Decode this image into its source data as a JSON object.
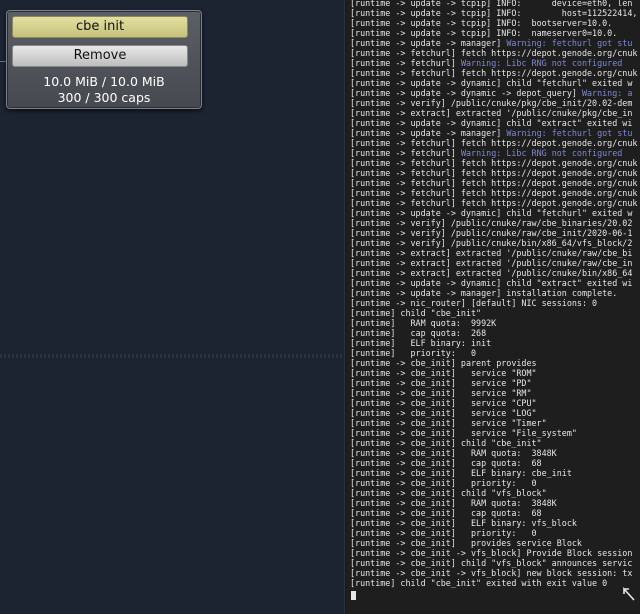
{
  "component_panel": {
    "name_button": "cbe init",
    "remove_button": "Remove",
    "ram_usage": "10.0 MiB / 10.0 MiB",
    "caps_usage": "300 / 300 caps"
  },
  "log": {
    "lines": [
      {
        "prefix": "[runtime -> update -> tcpip] INFO:",
        "text": "      device=eth0, len"
      },
      {
        "prefix": "[runtime -> update -> tcpip] INFO:",
        "text": "        host=112522414,"
      },
      {
        "prefix": "[runtime -> update -> tcpip] INFO:",
        "text": "  bootserver=10.0."
      },
      {
        "prefix": "[runtime -> update -> tcpip] INFO:",
        "text": "  nameserver0=10.0."
      },
      {
        "prefix": "[runtime -> update -> manager]",
        "warn": "Warning: fetchurl got stu"
      },
      {
        "prefix": "[runtime -> fetchurl] fetch https://depot.genode.org/cnuk",
        "text": ""
      },
      {
        "prefix": "[runtime -> fetchurl]",
        "warn": "Warning: Libc RNG not configured"
      },
      {
        "prefix": "[runtime -> fetchurl] fetch https://depot.genode.org/cnuk",
        "text": ""
      },
      {
        "prefix": "[runtime -> update -> dynamic] child \"fetchurl\" exited w",
        "text": ""
      },
      {
        "prefix": "[runtime -> update -> dynamic -> depot_query]",
        "warn": "Warning: a"
      },
      {
        "prefix": "[runtime -> verify] /public/cnuke/pkg/cbe_init/20.02-dem",
        "text": ""
      },
      {
        "prefix": "[runtime -> extract] extracted '/public/cnuke/pkg/cbe_in",
        "text": ""
      },
      {
        "prefix": "[runtime -> update -> dynamic] child \"extract\" exited wi",
        "text": ""
      },
      {
        "prefix": "[runtime -> update -> manager]",
        "warn": "Warning: fetchurl got stu"
      },
      {
        "prefix": "[runtime -> fetchurl] fetch https://depot.genode.org/cnuk",
        "text": ""
      },
      {
        "prefix": "[runtime -> fetchurl]",
        "warn": "Warning: Libc RNG not configured"
      },
      {
        "prefix": "[runtime -> fetchurl] fetch https://depot.genode.org/cnuk",
        "text": ""
      },
      {
        "prefix": "[runtime -> fetchurl] fetch https://depot.genode.org/cnuk",
        "text": ""
      },
      {
        "prefix": "[runtime -> fetchurl] fetch https://depot.genode.org/cnuk",
        "text": ""
      },
      {
        "prefix": "[runtime -> fetchurl] fetch https://depot.genode.org/cnuk",
        "text": ""
      },
      {
        "prefix": "[runtime -> fetchurl] fetch https://depot.genode.org/cnuk",
        "text": ""
      },
      {
        "prefix": "[runtime -> update -> dynamic] child \"fetchurl\" exited w",
        "text": ""
      },
      {
        "prefix": "[runtime -> verify] /public/cnuke/raw/cbe_binaries/20.02",
        "text": ""
      },
      {
        "prefix": "[runtime -> verify] /public/cnuke/raw/cbe_init/2020-06-1",
        "text": ""
      },
      {
        "prefix": "[runtime -> verify] /public/cnuke/bin/x86_64/vfs_block/2",
        "text": ""
      },
      {
        "prefix": "[runtime -> extract] extracted '/public/cnuke/raw/cbe_bi",
        "text": ""
      },
      {
        "prefix": "[runtime -> extract] extracted '/public/cnuke/raw/cbe_in",
        "text": ""
      },
      {
        "prefix": "[runtime -> extract] extracted '/public/cnuke/bin/x86_64",
        "text": ""
      },
      {
        "prefix": "[runtime -> update -> dynamic] child \"extract\" exited wi",
        "text": ""
      },
      {
        "prefix": "[runtime -> update -> manager] installation complete.",
        "text": ""
      },
      {
        "prefix": "[runtime -> nic_router] [default] NIC sessions: 0",
        "text": ""
      },
      {
        "prefix": "[runtime] child \"cbe_init\"",
        "text": ""
      },
      {
        "prefix": "[runtime]   RAM quota:  9992K",
        "text": ""
      },
      {
        "prefix": "[runtime]   cap quota:  268",
        "text": ""
      },
      {
        "prefix": "[runtime]   ELF binary: init",
        "text": ""
      },
      {
        "prefix": "[runtime]   priority:   0",
        "text": ""
      },
      {
        "prefix": "[runtime -> cbe_init] parent provides",
        "text": ""
      },
      {
        "prefix": "[runtime -> cbe_init]   service \"ROM\"",
        "text": ""
      },
      {
        "prefix": "[runtime -> cbe_init]   service \"PD\"",
        "text": ""
      },
      {
        "prefix": "[runtime -> cbe_init]   service \"RM\"",
        "text": ""
      },
      {
        "prefix": "[runtime -> cbe_init]   service \"CPU\"",
        "text": ""
      },
      {
        "prefix": "[runtime -> cbe_init]   service \"LOG\"",
        "text": ""
      },
      {
        "prefix": "[runtime -> cbe_init]   service \"Timer\"",
        "text": ""
      },
      {
        "prefix": "[runtime -> cbe_init]   service \"File_system\"",
        "text": ""
      },
      {
        "prefix": "[runtime -> cbe_init] child \"cbe_init\"",
        "text": ""
      },
      {
        "prefix": "[runtime -> cbe_init]   RAM quota:  3848K",
        "text": ""
      },
      {
        "prefix": "[runtime -> cbe_init]   cap quota:  68",
        "text": ""
      },
      {
        "prefix": "[runtime -> cbe_init]   ELF binary: cbe_init",
        "text": ""
      },
      {
        "prefix": "[runtime -> cbe_init]   priority:   0",
        "text": ""
      },
      {
        "prefix": "[runtime -> cbe_init] child \"vfs_block\"",
        "text": ""
      },
      {
        "prefix": "[runtime -> cbe_init]   RAM quota:  3848K",
        "text": ""
      },
      {
        "prefix": "[runtime -> cbe_init]   cap quota:  68",
        "text": ""
      },
      {
        "prefix": "[runtime -> cbe_init]   ELF binary: vfs_block",
        "text": ""
      },
      {
        "prefix": "[runtime -> cbe_init]   priority:   0",
        "text": ""
      },
      {
        "prefix": "[runtime -> cbe_init]   provides service Block",
        "text": ""
      },
      {
        "prefix": "[runtime -> cbe_init -> vfs_block] Provide Block session",
        "text": ""
      },
      {
        "prefix": "[runtime -> cbe_init] child \"vfs_block\" announces servic",
        "text": ""
      },
      {
        "prefix": "[runtime -> cbe_init -> vfs_block] new block session: tx",
        "text": ""
      },
      {
        "prefix": "[runtime] child \"cbe_init\" exited with exit value 0",
        "text": ""
      }
    ]
  },
  "colors": {
    "warning": "#7f88cc",
    "log_text": "#e6e6e6"
  }
}
